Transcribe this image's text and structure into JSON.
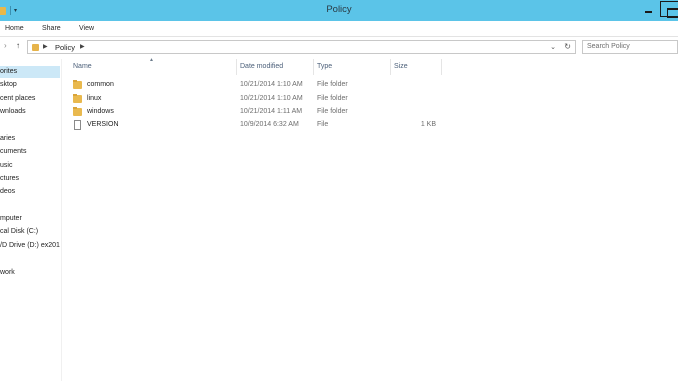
{
  "window": {
    "title": "Policy"
  },
  "ribbon": {
    "tabs": [
      "Home",
      "Share",
      "View"
    ]
  },
  "address": {
    "crumb": "Policy",
    "search_placeholder": "Search Policy"
  },
  "nav": {
    "items": [
      "orites",
      "sktop",
      "cent places",
      "wnloads",
      "aries",
      "cuments",
      "usic",
      "ctures",
      "deos",
      "mputer",
      "cal Disk (C:)",
      "/D Drive (D:) ex201",
      "work"
    ]
  },
  "columns": {
    "name": "Name",
    "date": "Date modified",
    "type": "Type",
    "size": "Size"
  },
  "files": [
    {
      "name": "common",
      "date": "10/21/2014 1:10 AM",
      "type": "File folder",
      "size": "",
      "icon": "folder-icon"
    },
    {
      "name": "linux",
      "date": "10/21/2014 1:10 AM",
      "type": "File folder",
      "size": "",
      "icon": "folder-icon"
    },
    {
      "name": "windows",
      "date": "10/21/2014 1:11 AM",
      "type": "File folder",
      "size": "",
      "icon": "folder-icon"
    },
    {
      "name": "VERSION",
      "date": "10/9/2014 6:32 AM",
      "type": "File",
      "size": "1 KB",
      "icon": "file-icon"
    }
  ],
  "colors": {
    "titlebar": "#5bc4e8",
    "selection": "#cce8f7",
    "folder": "#e9b94e"
  }
}
